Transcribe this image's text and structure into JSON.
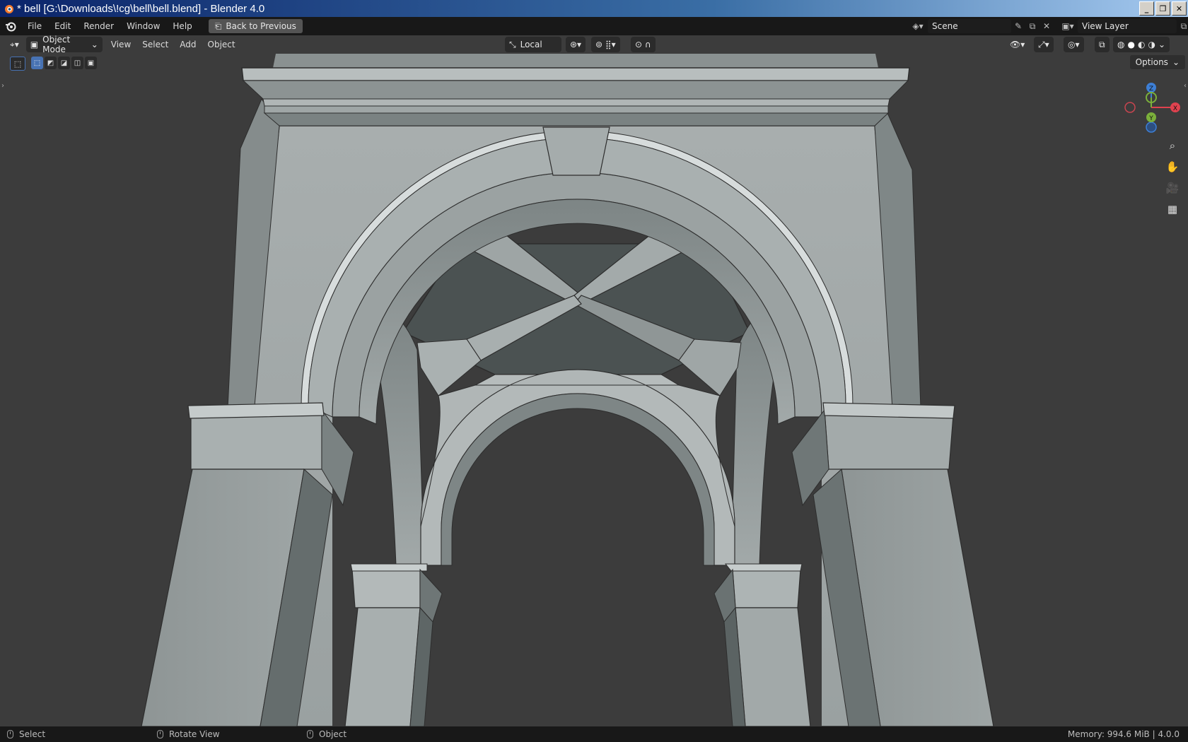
{
  "window": {
    "title": "* bell [G:\\Downloads\\!cg\\bell\\bell.blend] - Blender 4.0",
    "controls": [
      "_",
      "❐",
      "✕"
    ]
  },
  "menubar": {
    "items": [
      "File",
      "Edit",
      "Render",
      "Window",
      "Help"
    ],
    "back_button": "Back to Previous",
    "scene": "Scene",
    "view_layer": "View Layer"
  },
  "viewport_header": {
    "mode": "Object Mode",
    "menus": [
      "View",
      "Select",
      "Add",
      "Object"
    ],
    "transform_orientation": "Local",
    "options_label": "Options"
  },
  "gizmo": {
    "axes": [
      "Z",
      "Y",
      "X"
    ],
    "colors": {
      "x": "#e0424f",
      "y": "#7bb03b",
      "z": "#3d7fd6"
    }
  },
  "navigation_icons": [
    "zoom-icon",
    "pan-hand-icon",
    "camera-icon",
    "ortho-grid-icon"
  ],
  "statusbar": {
    "left_click": "Select",
    "middle_click": "Rotate View",
    "right_click": "Object",
    "memory": "Memory: 994.6 MiB | 4.0.0"
  },
  "colors": {
    "viewport_bg": "#3c3c3c",
    "header_bg": "#181818",
    "accent_blue": "#4772b3"
  }
}
